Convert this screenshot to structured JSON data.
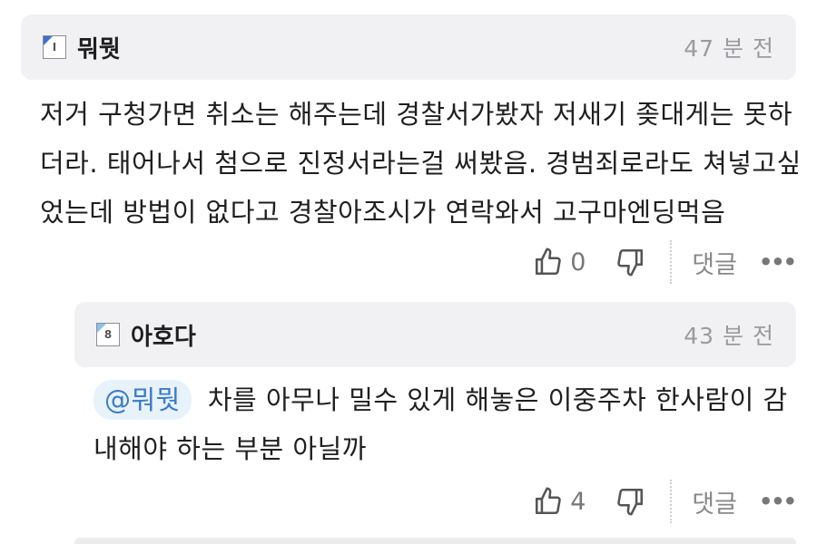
{
  "comment": {
    "username": "뭐뭣",
    "level": "I",
    "time": "47 분 전",
    "text": "저거 구청가면 취소는 해주는데 경찰서가봤자 저새기 좆대게는 못하더라. 태어나서 첨으로 진정서라는걸 써봤음. 경범죄로라도 쳐넣고싶었는데 방법이 없다고 경찰아조시가 연락와서 고구마엔딩먹음",
    "likes": "0",
    "reply_label": "댓글",
    "more": "•••"
  },
  "reply": {
    "username": "아호다",
    "level": "8",
    "time": "43 분 전",
    "mention": "@뭐뭣",
    "text": "차를 아무나 밀수 있게 해놓은 이중주차 한사람이 감내해야 하는 부분 아닐까",
    "likes": "4",
    "reply_label": "댓글",
    "more": "•••"
  },
  "icons": {
    "like": "thumbs-up-icon",
    "dislike": "thumbs-down-icon",
    "more": "more-dots-icon",
    "level": "level-badge-icon"
  },
  "colors": {
    "header_bg": "#f1f1f3",
    "mention_text": "#3d7bc7",
    "mention_bg": "#e8f2fb"
  }
}
